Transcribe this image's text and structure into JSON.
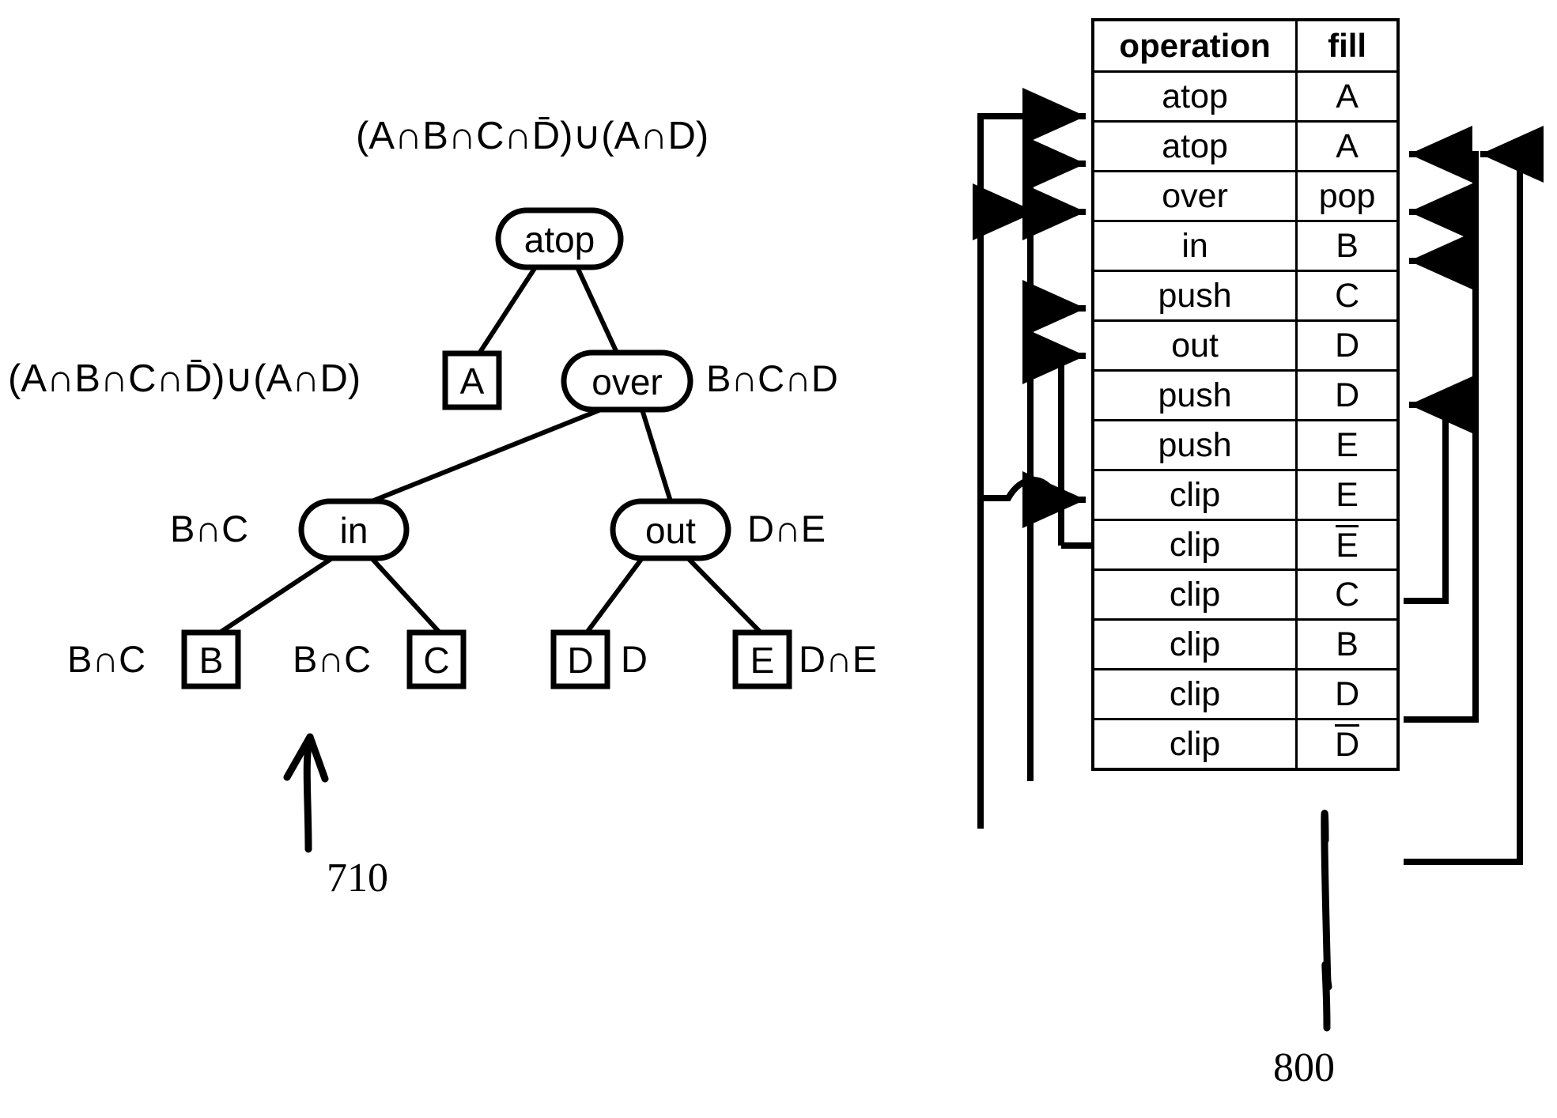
{
  "figure": {
    "tree": {
      "ref_number": "710",
      "root_formula": "(A∩B∩C∩D̄)∪(A∩D)",
      "nodes": [
        {
          "id": "atop",
          "label": "atop",
          "shape": "rounded"
        },
        {
          "id": "over",
          "label": "over",
          "shape": "rounded"
        },
        {
          "id": "in",
          "label": "in",
          "shape": "rounded"
        },
        {
          "id": "out",
          "label": "out",
          "shape": "rounded"
        }
      ],
      "leaves": [
        {
          "id": "A",
          "label": "A",
          "shape": "box"
        },
        {
          "id": "B",
          "label": "B",
          "shape": "box"
        },
        {
          "id": "C",
          "label": "C",
          "shape": "box"
        },
        {
          "id": "D",
          "label": "D",
          "shape": "box"
        },
        {
          "id": "E",
          "label": "E",
          "shape": "box"
        }
      ],
      "annotations": {
        "atop_top": "(A∩B∩C∩D̄)∪(A∩D)",
        "a_left": "(A∩B∩C∩D̄)∪(A∩D)",
        "over_right": "B∩C∩D",
        "in_left": "B∩C",
        "out_right": "D∩E",
        "b_left": "B∩C",
        "c_left": "B∩C",
        "d_right": "D",
        "e_right": "D∩E"
      }
    },
    "table": {
      "ref_number": "800",
      "headers": [
        "operation",
        "fill"
      ],
      "rows": [
        {
          "operation": "atop",
          "fill": "A",
          "fill_overline": false
        },
        {
          "operation": "atop",
          "fill": "A",
          "fill_overline": false
        },
        {
          "operation": "over",
          "fill": "pop",
          "fill_overline": false
        },
        {
          "operation": "in",
          "fill": "B",
          "fill_overline": false
        },
        {
          "operation": "push",
          "fill": "C",
          "fill_overline": false
        },
        {
          "operation": "out",
          "fill": "D",
          "fill_overline": false
        },
        {
          "operation": "push",
          "fill": "D",
          "fill_overline": false
        },
        {
          "operation": "push",
          "fill": "E",
          "fill_overline": false
        },
        {
          "operation": "clip",
          "fill": "E",
          "fill_overline": false
        },
        {
          "operation": "clip",
          "fill": "E",
          "fill_overline": true
        },
        {
          "operation": "clip",
          "fill": "C",
          "fill_overline": false
        },
        {
          "operation": "clip",
          "fill": "B",
          "fill_overline": false
        },
        {
          "operation": "clip",
          "fill": "D",
          "fill_overline": false
        },
        {
          "operation": "clip",
          "fill": "D",
          "fill_overline": true
        }
      ]
    },
    "colors": {
      "ink": "#000000",
      "background": "#ffffff"
    }
  }
}
